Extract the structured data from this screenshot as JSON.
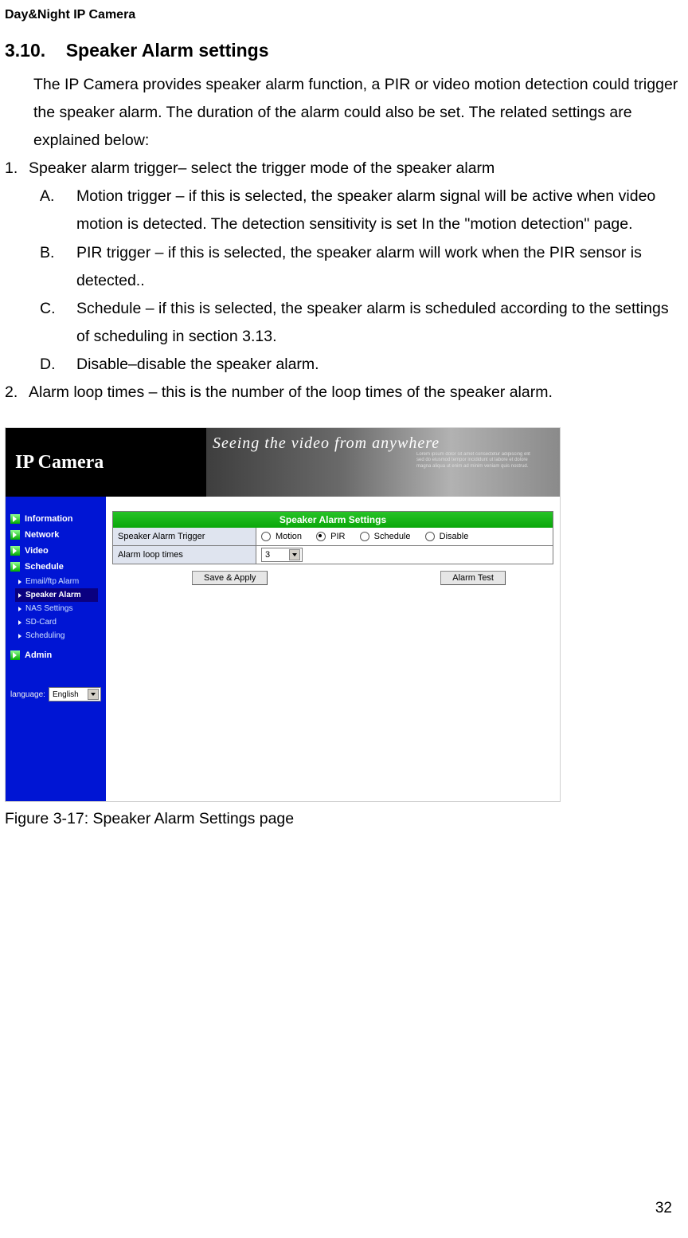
{
  "header": "Day&Night IP Camera",
  "section_number": "3.10.",
  "section_title": "Speaker Alarm settings",
  "intro": "The IP Camera provides speaker alarm function, a PIR or video motion detection could trigger the speaker alarm. The duration of the alarm could also be set. The related settings are explained below:",
  "list1": {
    "num": "1.",
    "text": "Speaker alarm trigger– select the trigger mode of the speaker alarm"
  },
  "sub_a": {
    "letter": "A.",
    "text": "Motion trigger – if this is selected, the speaker alarm signal will be active when video motion is detected. The detection sensitivity is set In the \"motion detection\" page."
  },
  "sub_b": {
    "letter": "B.",
    "text": "PIR trigger – if this is selected, the speaker alarm will work when the PIR sensor is detected.."
  },
  "sub_c": {
    "letter": "C.",
    "text": "Schedule – if this is selected, the speaker alarm is scheduled according to the settings of scheduling in section 3.13."
  },
  "sub_d": {
    "letter": "D.",
    "text": "Disable–disable the speaker alarm."
  },
  "list2": {
    "num": "2.",
    "text": "Alarm loop times – this is the number of the loop times of the speaker alarm."
  },
  "figure_caption": "Figure 3-17: Speaker Alarm Settings page",
  "page_number": "32",
  "screenshot": {
    "banner_brand": "IP Camera",
    "banner_slogan": "Seeing the video from anywhere",
    "sidebar": {
      "items": [
        "Information",
        "Network",
        "Video",
        "Schedule"
      ],
      "subitems": [
        "Email/ftp Alarm",
        "Speaker Alarm",
        "NAS Settings",
        "SD-Card",
        "Scheduling"
      ],
      "admin": "Admin",
      "language_label": "language:",
      "language_value": "English"
    },
    "panel": {
      "title": "Speaker Alarm Settings",
      "row1_label": "Speaker Alarm Trigger",
      "radios": [
        "Motion",
        "PIR",
        "Schedule",
        "Disable"
      ],
      "row2_label": "Alarm loop times",
      "select_value": "3",
      "save_button": "Save & Apply",
      "test_button": "Alarm Test"
    }
  }
}
